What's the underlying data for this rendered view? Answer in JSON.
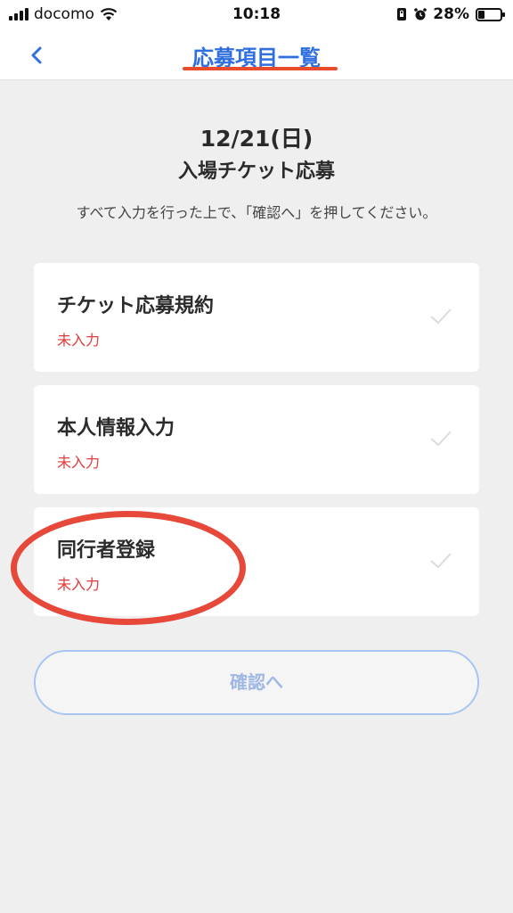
{
  "status_bar": {
    "carrier": "docomo",
    "time": "10:18",
    "battery": "28%",
    "battery_level": 0.28,
    "icons": [
      "signal-icon",
      "wifi-icon",
      "portrait-lock-icon",
      "alarm-icon",
      "battery-icon"
    ]
  },
  "nav": {
    "title": "応募項目一覧",
    "back_icon": "chevron-left-icon"
  },
  "header": {
    "date": "12/21(日)",
    "title": "入場チケット応募",
    "instruction": "すべて入力を行った上で、「確認へ」を押してください。"
  },
  "items": [
    {
      "title": "チケット応募規約",
      "status": "未入力"
    },
    {
      "title": "本人情報入力",
      "status": "未入力"
    },
    {
      "title": "同行者登録",
      "status": "未入力"
    }
  ],
  "confirm_button": {
    "label": "確認へ"
  },
  "colors": {
    "accent": "#2f6fe0",
    "annotation": "#e6493a",
    "status_incomplete": "#e23b3b",
    "disabled_button_text": "#9fb8e6"
  }
}
